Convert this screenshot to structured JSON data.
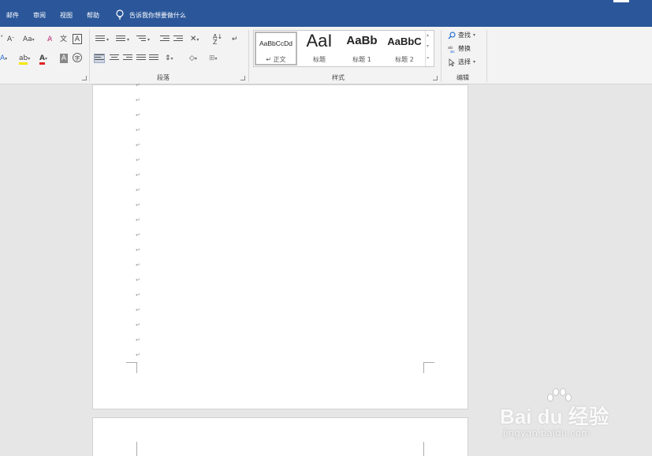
{
  "menu": {
    "items": [
      "邮件",
      "审阅",
      "视图",
      "帮助"
    ],
    "tell_me": "告诉我你想要做什么"
  },
  "ribbon": {
    "groups": {
      "paragraph": "段落",
      "styles": "样式",
      "editing": "编辑"
    },
    "styles": [
      {
        "sample": "AaBbCcDd",
        "name": "↵ 正文"
      },
      {
        "sample": "AaI",
        "name": "标题"
      },
      {
        "sample": "AaBb",
        "name": "标题 1"
      },
      {
        "sample": "AaBbC",
        "name": "标题 2"
      }
    ],
    "edit": {
      "find": "查找",
      "replace": "替换",
      "select": "选择"
    },
    "font": {
      "change_case": "Aa"
    }
  },
  "document": {
    "paragraph_mark": "↵",
    "paragraph_count": 19
  },
  "watermark": {
    "logo": "Bai du 经验",
    "url": "jingyan.baidu.com"
  },
  "colors": {
    "title_bar": "#2b579a",
    "ribbon": "#f3f3f3",
    "workspace": "#e6e6e6",
    "font_color_underline": "#e02020",
    "highlight_color": "#f5e600"
  }
}
